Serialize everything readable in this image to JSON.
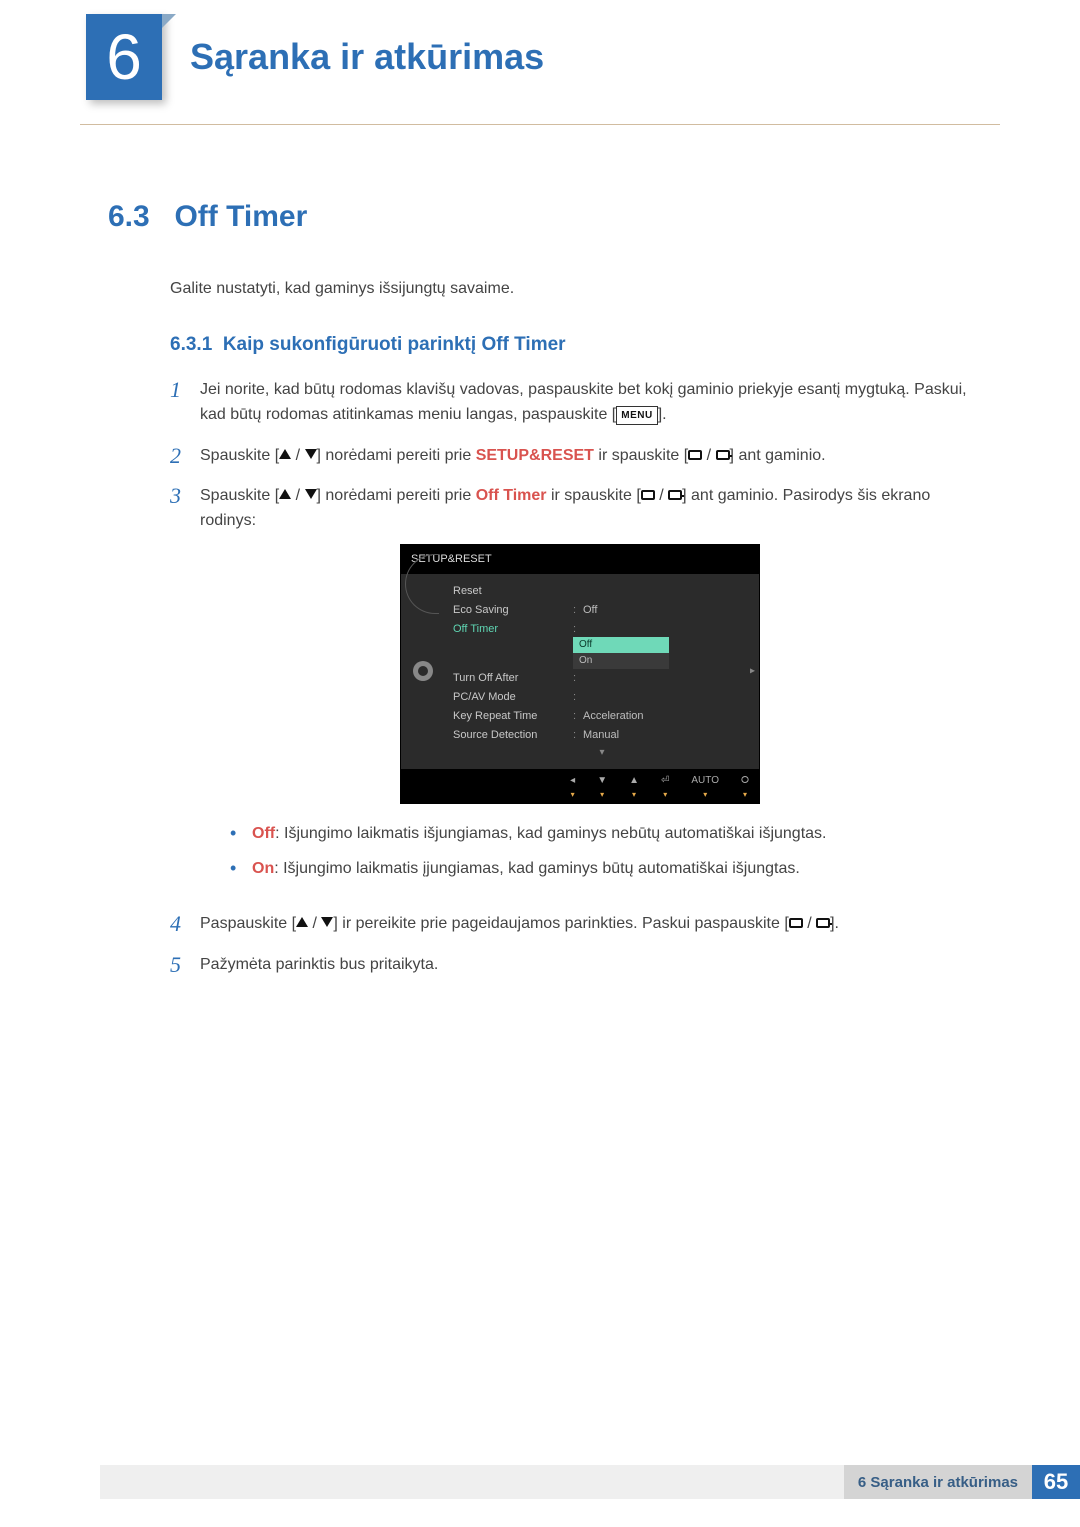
{
  "header": {
    "chapter_number": "6",
    "chapter_title": "Sąranka ir atkūrimas"
  },
  "section": {
    "number": "6.3",
    "title": "Off Timer",
    "intro": "Galite nustatyti, kad gaminys išsijungtų savaime."
  },
  "subsection": {
    "number": "6.3.1",
    "title": "Kaip sukonfigūruoti parinktį Off Timer"
  },
  "steps": {
    "s1a": "Jei norite, kad būtų rodomas klavišų vadovas, paspauskite bet kokį gaminio priekyje esantį mygtuką. Paskui, kad būtų rodomas atitinkamas meniu langas, paspauskite [",
    "s1_menu": "MENU",
    "s1b": "].",
    "s2a": "Spauskite [",
    "s2b": "] norėdami pereiti prie ",
    "s2_hl": "SETUP&RESET",
    "s2c": " ir spauskite [",
    "s2d": "] ant gaminio.",
    "s3a": "Spauskite [",
    "s3b": "] norėdami pereiti prie ",
    "s3_hl": "Off Timer",
    "s3c": " ir spauskite [",
    "s3d": "] ant gaminio. Pasirodys šis ekrano rodinys:",
    "s4a": "Paspauskite [",
    "s4b": "] ir pereikite prie pageidaujamos parinkties. Paskui paspauskite [",
    "s4c": "].",
    "s5": "Pažymėta parinktis bus pritaikyta."
  },
  "osd": {
    "title": "SETUP&RESET",
    "rows": {
      "reset": "Reset",
      "eco": "Eco Saving",
      "eco_val": "Off",
      "offtimer": "Off Timer",
      "opt_off": "Off",
      "opt_on": "On",
      "turnoff": "Turn Off After",
      "pcav": "PC/AV Mode",
      "keyrep": "Key Repeat Time",
      "keyrep_val": "Acceleration",
      "srcdet": "Source Detection",
      "srcdet_val": "Manual"
    },
    "footer_auto": "AUTO"
  },
  "bullets": {
    "off_label": "Off",
    "off_text": ": Išjungimo laikmatis išjungiamas, kad gaminys nebūtų automatiškai išjungtas.",
    "on_label": "On",
    "on_text": ": Išjungimo laikmatis įjungiamas, kad gaminys būtų automatiškai išjungtas."
  },
  "footer": {
    "label": "6 Sąranka ir atkūrimas",
    "page": "65"
  }
}
